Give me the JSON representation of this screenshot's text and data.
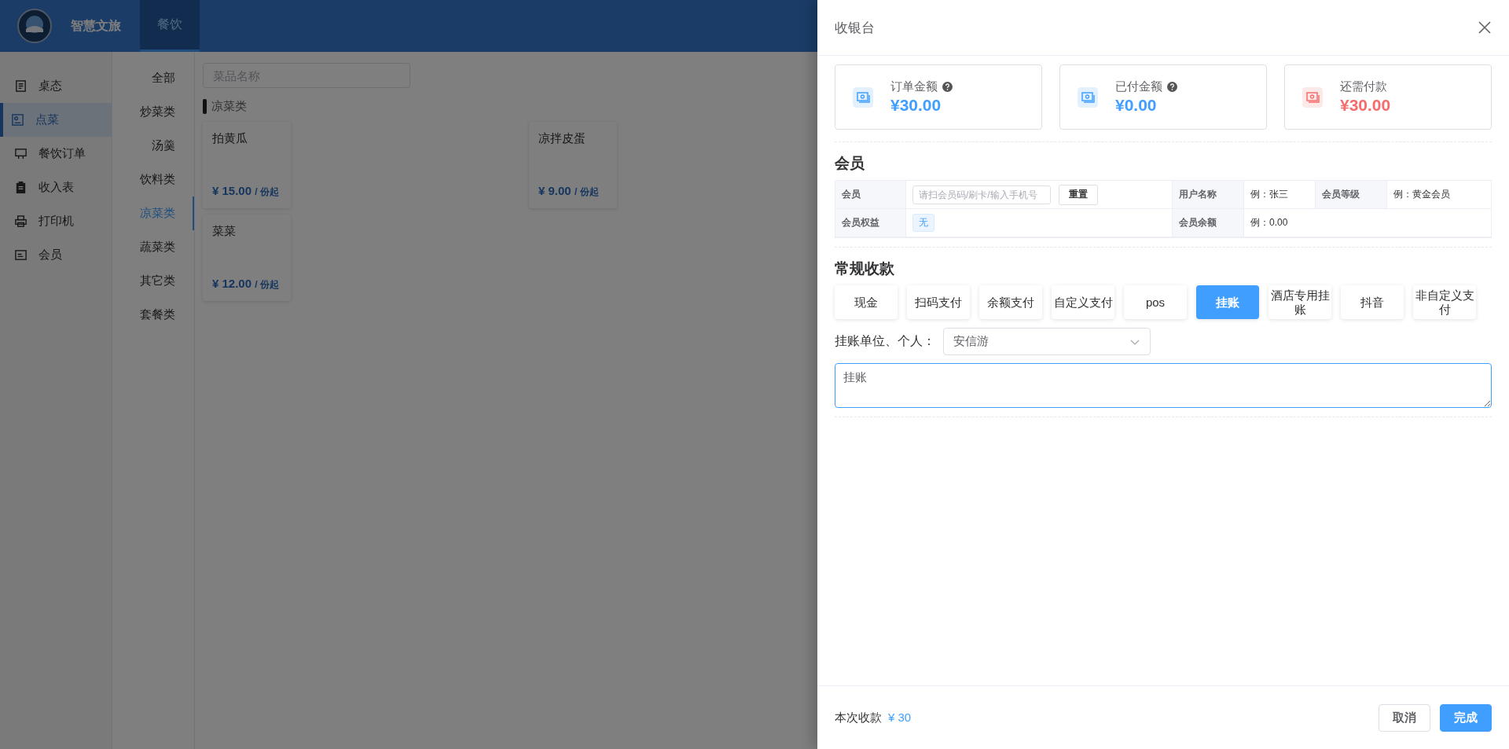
{
  "header": {
    "app_title": "智慧文旅",
    "tabs": [
      {
        "label": "餐饮",
        "selected": true
      }
    ]
  },
  "sidebar": {
    "items": [
      {
        "label": "桌态",
        "selected": false
      },
      {
        "label": "点菜",
        "selected": true
      },
      {
        "label": "餐饮订单",
        "selected": false
      },
      {
        "label": "收入表",
        "selected": false
      },
      {
        "label": "打印机",
        "selected": false
      },
      {
        "label": "会员",
        "selected": false
      }
    ]
  },
  "categories": [
    {
      "label": "全部",
      "selected": false
    },
    {
      "label": "炒菜类",
      "selected": false
    },
    {
      "label": "汤羹",
      "selected": false
    },
    {
      "label": "饮料类",
      "selected": false
    },
    {
      "label": "凉菜类",
      "selected": true
    },
    {
      "label": "蔬菜类",
      "selected": false
    },
    {
      "label": "其它类",
      "selected": false
    },
    {
      "label": "套餐类",
      "selected": false
    }
  ],
  "search": {
    "placeholder": "菜品名称"
  },
  "section_title": "凉菜类",
  "dishes": [
    {
      "name": "拍黄瓜",
      "price": "¥ 15.00",
      "unit": "/ 份起"
    },
    {
      "name": "凉拌皮蛋",
      "price": "¥ 9.00",
      "unit": "/ 份起"
    },
    {
      "name": "菜菜",
      "price": "¥ 12.00",
      "unit": "/ 份起"
    }
  ],
  "drawer": {
    "title": "收银台",
    "summary": [
      {
        "label": "订单金额",
        "help_icon": true,
        "amount": "¥30.00",
        "color": "#409eff"
      },
      {
        "label": "已付金额",
        "help_icon": true,
        "amount": "¥0.00",
        "color": "#409eff"
      },
      {
        "label": "还需付款",
        "help_icon": false,
        "amount": "¥30.00",
        "color": "#f56c6c"
      }
    ],
    "member": {
      "heading": "会员",
      "search_label": "会员",
      "search_placeholder": "请扫会员码/刷卡/输入手机号",
      "reset_button": "重置",
      "username_label": "用户名称",
      "username_value": "例：张三",
      "level_label": "会员等级",
      "level_value": "例：黄金会员",
      "benefits_label": "会员权益",
      "benefits_tag": "无",
      "balance_label": "会员余额",
      "balance_value": "例：0.00"
    },
    "payment": {
      "heading": "常规收款",
      "methods": [
        {
          "label": "现金",
          "selected": false
        },
        {
          "label": "扫码支付",
          "selected": false
        },
        {
          "label": "余额支付",
          "selected": false
        },
        {
          "label": "自定义支付",
          "selected": false
        },
        {
          "label": "pos",
          "selected": false
        },
        {
          "label": "挂账",
          "selected": true
        },
        {
          "label": "酒店专用挂账",
          "selected": false
        },
        {
          "label": "抖音",
          "selected": false
        },
        {
          "label": "非自定义支付",
          "selected": false
        }
      ],
      "account_label": "挂账单位、个人：",
      "account_value": "安信游",
      "remark": "挂账"
    },
    "footer": {
      "label": "本次收款",
      "amount": "¥ 30",
      "cancel_button": "取消",
      "confirm_button": "完成"
    }
  }
}
